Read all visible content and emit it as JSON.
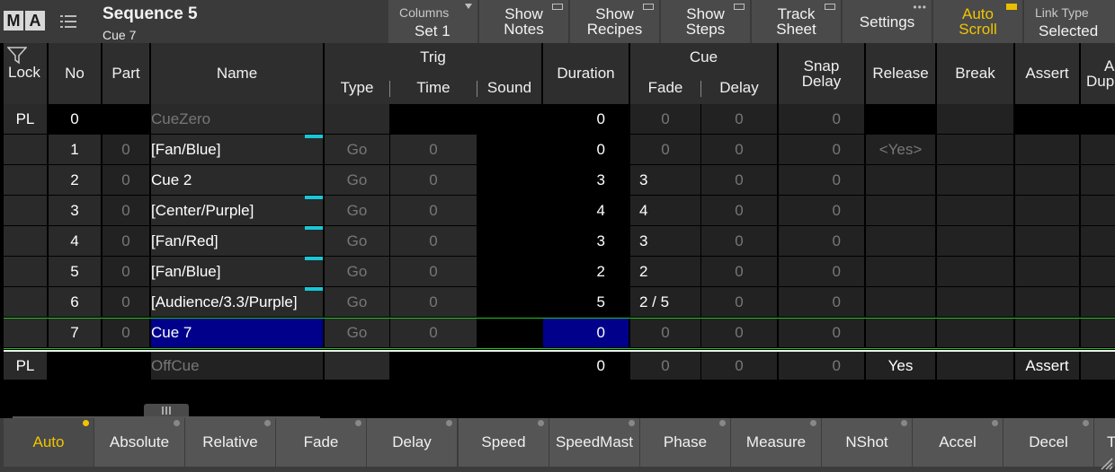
{
  "window": {
    "logo": [
      "M",
      "A"
    ],
    "title": "Sequence 5",
    "subtitle": "Cue 7"
  },
  "toolbar": {
    "columns_label": "Columns",
    "columns_value": "Set 1",
    "show_notes": [
      "Show",
      "Notes"
    ],
    "show_recipes": [
      "Show",
      "Recipes"
    ],
    "show_steps": [
      "Show",
      "Steps"
    ],
    "track_sheet": [
      "Track",
      "Sheet"
    ],
    "settings": "Settings",
    "auto_scroll": [
      "Auto",
      "Scroll"
    ],
    "link_type_label": "Link Type",
    "link_type_value": "Selected",
    "accent": "#f0c400"
  },
  "headers": {
    "lock": "Lock",
    "no": "No",
    "part": "Part",
    "name": "Name",
    "trig": "Trig",
    "type": "Type",
    "time": "Time",
    "sound": "Sound",
    "duration": "Duration",
    "cue": "Cue",
    "fade": "Fade",
    "delay": "Delay",
    "snap_delay": [
      "Snap",
      "Delay"
    ],
    "release": "Release",
    "break": "Break",
    "assert": "Assert",
    "all_dup": [
      "A",
      "Dup"
    ]
  },
  "rows": [
    {
      "lock": "PL",
      "no": "0",
      "part": "",
      "name": "CueZero",
      "type": "",
      "time": "",
      "duration": "0",
      "fade": "0",
      "delay": "0",
      "snap": "0",
      "release": "",
      "assert": "",
      "marker": false
    },
    {
      "lock": "",
      "no": "1",
      "part": "0",
      "name": "[Fan/Blue]",
      "type": "Go",
      "time": "0",
      "duration": "0",
      "fade": "0",
      "delay": "0",
      "snap": "0",
      "release": "<Yes>",
      "assert": "",
      "marker": true
    },
    {
      "lock": "",
      "no": "2",
      "part": "0",
      "name": "Cue  2",
      "type": "Go",
      "time": "0",
      "duration": "3",
      "fade": "3",
      "delay": "0",
      "snap": "0",
      "release": "",
      "assert": "",
      "marker": false
    },
    {
      "lock": "",
      "no": "3",
      "part": "0",
      "name": "[Center/Purple]",
      "type": "Go",
      "time": "0",
      "duration": "4",
      "fade": "4",
      "delay": "0",
      "snap": "0",
      "release": "",
      "assert": "",
      "marker": true
    },
    {
      "lock": "",
      "no": "4",
      "part": "0",
      "name": "[Fan/Red]",
      "type": "Go",
      "time": "0",
      "duration": "3",
      "fade": "3",
      "delay": "0",
      "snap": "0",
      "release": "",
      "assert": "",
      "marker": true
    },
    {
      "lock": "",
      "no": "5",
      "part": "0",
      "name": "[Fan/Blue]",
      "type": "Go",
      "time": "0",
      "duration": "2",
      "fade": "2",
      "delay": "0",
      "snap": "0",
      "release": "",
      "assert": "",
      "marker": true
    },
    {
      "lock": "",
      "no": "6",
      "part": "0",
      "name": "[Audience/3.3/Purple]",
      "type": "Go",
      "time": "0",
      "duration": "5",
      "fade": "2  /  5",
      "delay": "0",
      "snap": "0",
      "release": "",
      "assert": "",
      "marker": true
    },
    {
      "lock": "",
      "no": "7",
      "part": "0",
      "name": "Cue  7",
      "type": "Go",
      "time": "0",
      "duration": "0",
      "fade": "0",
      "delay": "0",
      "snap": "0",
      "release": "",
      "assert": "",
      "marker": false
    },
    {
      "lock": "PL",
      "no": "",
      "part": "",
      "name": "OffCue",
      "type": "",
      "time": "",
      "duration": "0",
      "fade": "0",
      "delay": "0",
      "snap": "0",
      "release": "Yes",
      "assert": "Assert",
      "marker": false
    }
  ],
  "selected_row": 7,
  "colors": {
    "selection": "#00008b",
    "marker": "#16c8d8",
    "current_line": "#22c422"
  },
  "bottom_buttons": [
    "Auto",
    "Absolute",
    "Relative",
    "Fade",
    "Delay",
    "Speed",
    "SpeedMast",
    "Phase",
    "Measure",
    "NShot",
    "Accel",
    "Decel",
    "T"
  ]
}
